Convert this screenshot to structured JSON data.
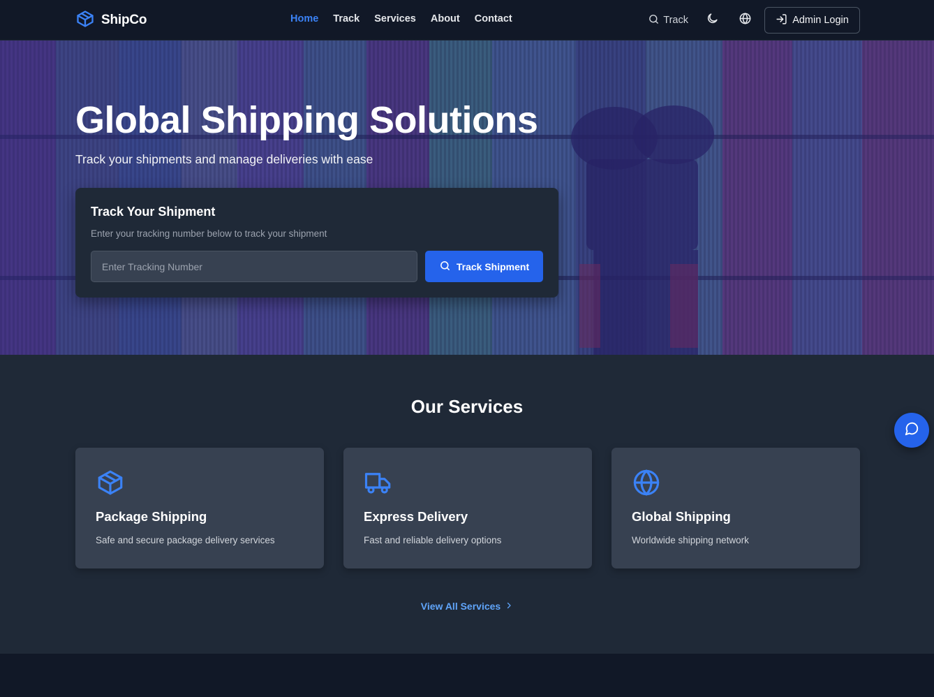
{
  "brand": {
    "name": "ShipCo",
    "accent": "#3b82f6"
  },
  "nav": {
    "links": [
      {
        "label": "Home",
        "active": true
      },
      {
        "label": "Track",
        "active": false
      },
      {
        "label": "Services",
        "active": false
      },
      {
        "label": "About",
        "active": false
      },
      {
        "label": "Contact",
        "active": false
      }
    ],
    "track_label": "Track",
    "theme_icon": "moon-icon",
    "language_icon": "globe-icon",
    "admin_label": "Admin Login"
  },
  "hero": {
    "title": "Global Shipping Solutions",
    "subtitle": "Track your shipments and manage deliveries with ease",
    "card": {
      "title": "Track Your Shipment",
      "description": "Enter your tracking number below to track your shipment",
      "input_value": "",
      "input_placeholder": "Enter Tracking Number",
      "button_label": "Track Shipment"
    }
  },
  "services": {
    "title": "Our Services",
    "items": [
      {
        "icon": "package-icon",
        "title": "Package Shipping",
        "description": "Safe and secure package delivery services"
      },
      {
        "icon": "truck-icon",
        "title": "Express Delivery",
        "description": "Fast and reliable delivery options"
      },
      {
        "icon": "globe-icon",
        "title": "Global Shipping",
        "description": "Worldwide shipping network"
      }
    ],
    "view_all_label": "View All Services"
  },
  "chat": {
    "icon": "chat-icon"
  },
  "colors": {
    "primary": "#2563eb",
    "background": "#111827",
    "surface": "#1f2937",
    "card": "#374151"
  }
}
